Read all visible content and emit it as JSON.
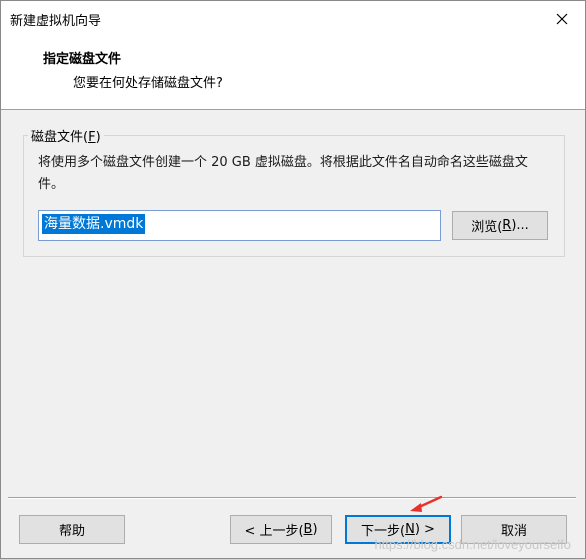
{
  "window": {
    "title": "新建虚拟机向导"
  },
  "header": {
    "title": "指定磁盘文件",
    "subtitle": "您要在何处存储磁盘文件?"
  },
  "group": {
    "label_main": "磁盘文件(",
    "label_key": "F",
    "label_end": ")",
    "description": "将使用多个磁盘文件创建一个 20 GB 虚拟磁盘。将根据此文件名自动命名这些磁盘文件。",
    "file_value": "海量数据.vmdk",
    "browse_main": "浏览(",
    "browse_key": "R",
    "browse_end": ")..."
  },
  "footer": {
    "help": "帮助",
    "back_main": "< 上一步(",
    "back_key": "B",
    "back_end": ")",
    "next_main": "下一步(",
    "next_key": "N",
    "next_end": ") >",
    "cancel": "取消"
  },
  "watermark": "https://blog.csdn.net/loveyourselfo",
  "colors": {
    "selection": "#0078d7",
    "annotation_arrow": "#e5322c"
  }
}
